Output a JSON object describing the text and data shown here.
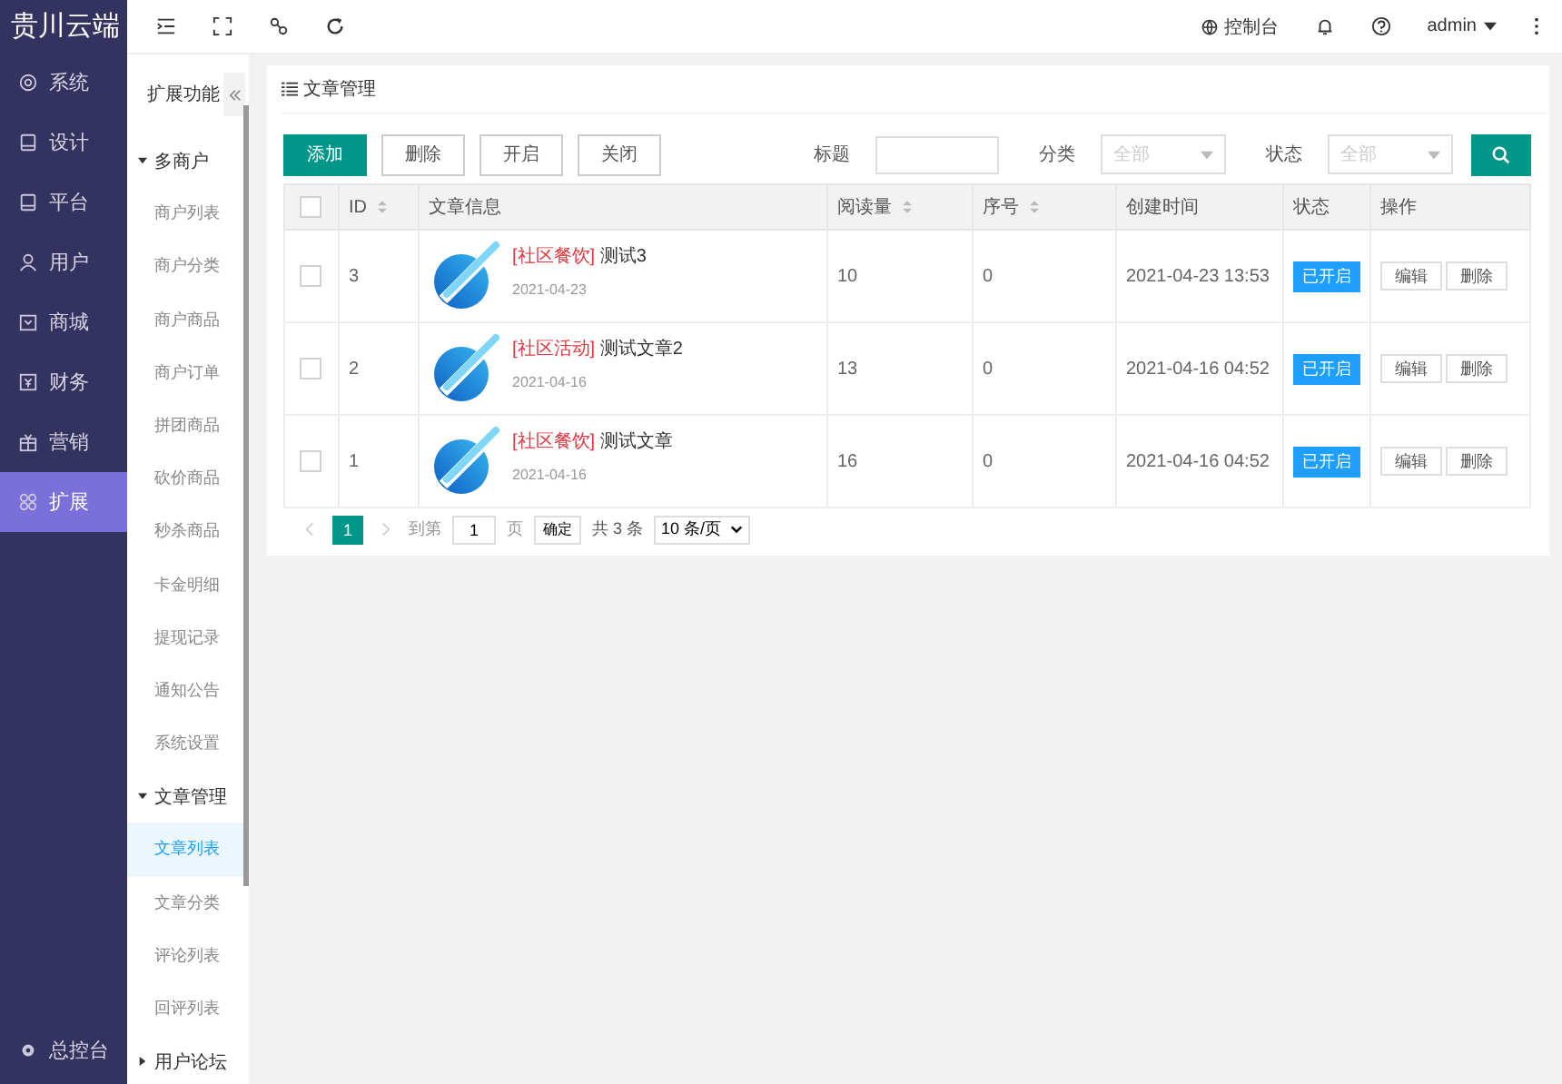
{
  "brand": "贵川云端",
  "topbar": {
    "console": "控制台",
    "user": "admin"
  },
  "main_menu": [
    {
      "label": "系统",
      "kind": "gear",
      "selected": false
    },
    {
      "label": "设计",
      "kind": "tablet",
      "selected": false
    },
    {
      "label": "平台",
      "kind": "tablet",
      "selected": false
    },
    {
      "label": "用户",
      "kind": "user",
      "selected": false
    },
    {
      "label": "商城",
      "kind": "box",
      "selected": false
    },
    {
      "label": "财务",
      "kind": "money",
      "selected": false
    },
    {
      "label": "营销",
      "kind": "gift",
      "selected": false
    },
    {
      "label": "扩展",
      "kind": "grid",
      "selected": true
    }
  ],
  "bottom_menu": {
    "label": "总控台"
  },
  "submenu": {
    "title": "扩展功能",
    "groups": [
      {
        "label": "多商户",
        "expanded": true,
        "children": [
          {
            "label": "商户列表",
            "selected": false
          },
          {
            "label": "商户分类",
            "selected": false
          },
          {
            "label": "商户商品",
            "selected": false
          },
          {
            "label": "商户订单",
            "selected": false
          },
          {
            "label": "拼团商品",
            "selected": false
          },
          {
            "label": "砍价商品",
            "selected": false
          },
          {
            "label": "秒杀商品",
            "selected": false
          },
          {
            "label": "卡金明细",
            "selected": false
          },
          {
            "label": "提现记录",
            "selected": false
          },
          {
            "label": "通知公告",
            "selected": false
          },
          {
            "label": "系统设置",
            "selected": false
          }
        ]
      },
      {
        "label": "文章管理",
        "expanded": true,
        "children": [
          {
            "label": "文章列表",
            "selected": true
          },
          {
            "label": "文章分类",
            "selected": false
          },
          {
            "label": "评论列表",
            "selected": false
          },
          {
            "label": "回评列表",
            "selected": false
          }
        ]
      },
      {
        "label": "用户论坛",
        "expanded": false
      }
    ]
  },
  "panel": {
    "title": "文章管理",
    "buttons": [
      {
        "label": "添加",
        "kind": "primary"
      },
      {
        "label": "删除",
        "kind": "plain"
      },
      {
        "label": "开启",
        "kind": "plain"
      },
      {
        "label": "关闭",
        "kind": "plain"
      }
    ],
    "filters": [
      {
        "label": "标题",
        "kind": "text"
      },
      {
        "label": "分类",
        "kind": "select",
        "placeholder": "全部"
      },
      {
        "label": "状态",
        "kind": "select",
        "placeholder": "全部"
      }
    ],
    "table": {
      "all_checked": false,
      "columns": [
        {
          "label": "ID",
          "sortable": true
        },
        {
          "label": "文章信息",
          "sortable": false
        },
        {
          "label": "阅读量",
          "sortable": true
        },
        {
          "label": "序号",
          "sortable": true
        },
        {
          "label": "创建时间",
          "sortable": false
        },
        {
          "label": "状态",
          "sortable": false
        },
        {
          "label": "操作",
          "sortable": false
        }
      ],
      "rows": [
        {
          "checked": false,
          "id": "3",
          "tag": "[社区餐饮]",
          "title": "测试3",
          "date": "2021-04-23",
          "reads": "10",
          "order": "0",
          "created": "2021-04-23 13:53",
          "status": "已开启",
          "actions": [
            "编辑",
            "删除"
          ]
        },
        {
          "checked": false,
          "id": "2",
          "tag": "[社区活动]",
          "title": "测试文章2",
          "date": "2021-04-16",
          "reads": "13",
          "order": "0",
          "created": "2021-04-16 04:52",
          "status": "已开启",
          "actions": [
            "编辑",
            "删除"
          ]
        },
        {
          "checked": false,
          "id": "1",
          "tag": "[社区餐饮]",
          "title": "测试文章",
          "date": "2021-04-16",
          "reads": "16",
          "order": "0",
          "created": "2021-04-16 04:52",
          "status": "已开启",
          "actions": [
            "编辑",
            "删除"
          ]
        }
      ]
    },
    "pagination": {
      "pages": [
        {
          "label": "1",
          "selected": true
        }
      ],
      "goto_label": "到第",
      "goto_value": "1",
      "page_unit": "页",
      "confirm": "确定",
      "total": "共 3 条",
      "page_size": "10 条/页"
    }
  }
}
